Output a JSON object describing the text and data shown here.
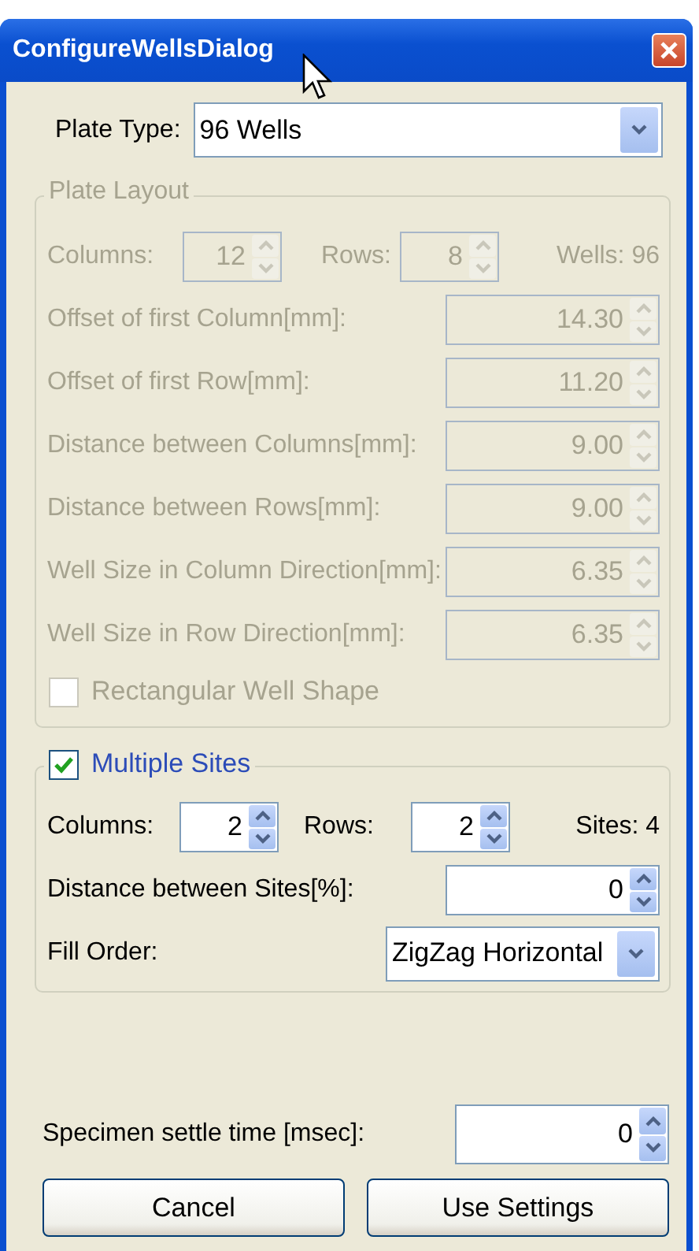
{
  "window": {
    "title": "ConfigureWellsDialog"
  },
  "plate_type": {
    "label": "Plate Type:",
    "value": "96 Wells"
  },
  "plate_layout": {
    "title": "Plate Layout",
    "disabled": true,
    "columns": {
      "label": "Columns:",
      "value": "12"
    },
    "rows": {
      "label": "Rows:",
      "value": "8"
    },
    "wells": "Wells: 96",
    "fields": [
      {
        "label": "Offset of first Column[mm]:",
        "value": "14.30"
      },
      {
        "label": "Offset of first Row[mm]:",
        "value": "11.20"
      },
      {
        "label": "Distance between Columns[mm]:",
        "value": "9.00"
      },
      {
        "label": "Distance between Rows[mm]:",
        "value": "9.00"
      },
      {
        "label": "Well Size in Column Direction[mm]:",
        "value": "6.35"
      },
      {
        "label": "Well Size in Row Direction[mm]:",
        "value": "6.35"
      }
    ],
    "rectangular": {
      "label": "Rectangular Well Shape",
      "checked": false
    }
  },
  "multiple_sites": {
    "title": "Multiple Sites",
    "checked": true,
    "columns": {
      "label": "Columns:",
      "value": "2"
    },
    "rows": {
      "label": "Rows:",
      "value": "2"
    },
    "sites": "Sites: 4",
    "distance": {
      "label": "Distance between Sites[%]:",
      "value": "0"
    },
    "fill_order": {
      "label": "Fill Order:",
      "value": "ZigZag Horizontal"
    }
  },
  "settle_time": {
    "label": "Specimen settle time [msec]:",
    "value": "0"
  },
  "buttons": [
    "Cancel",
    "Use Settings"
  ]
}
